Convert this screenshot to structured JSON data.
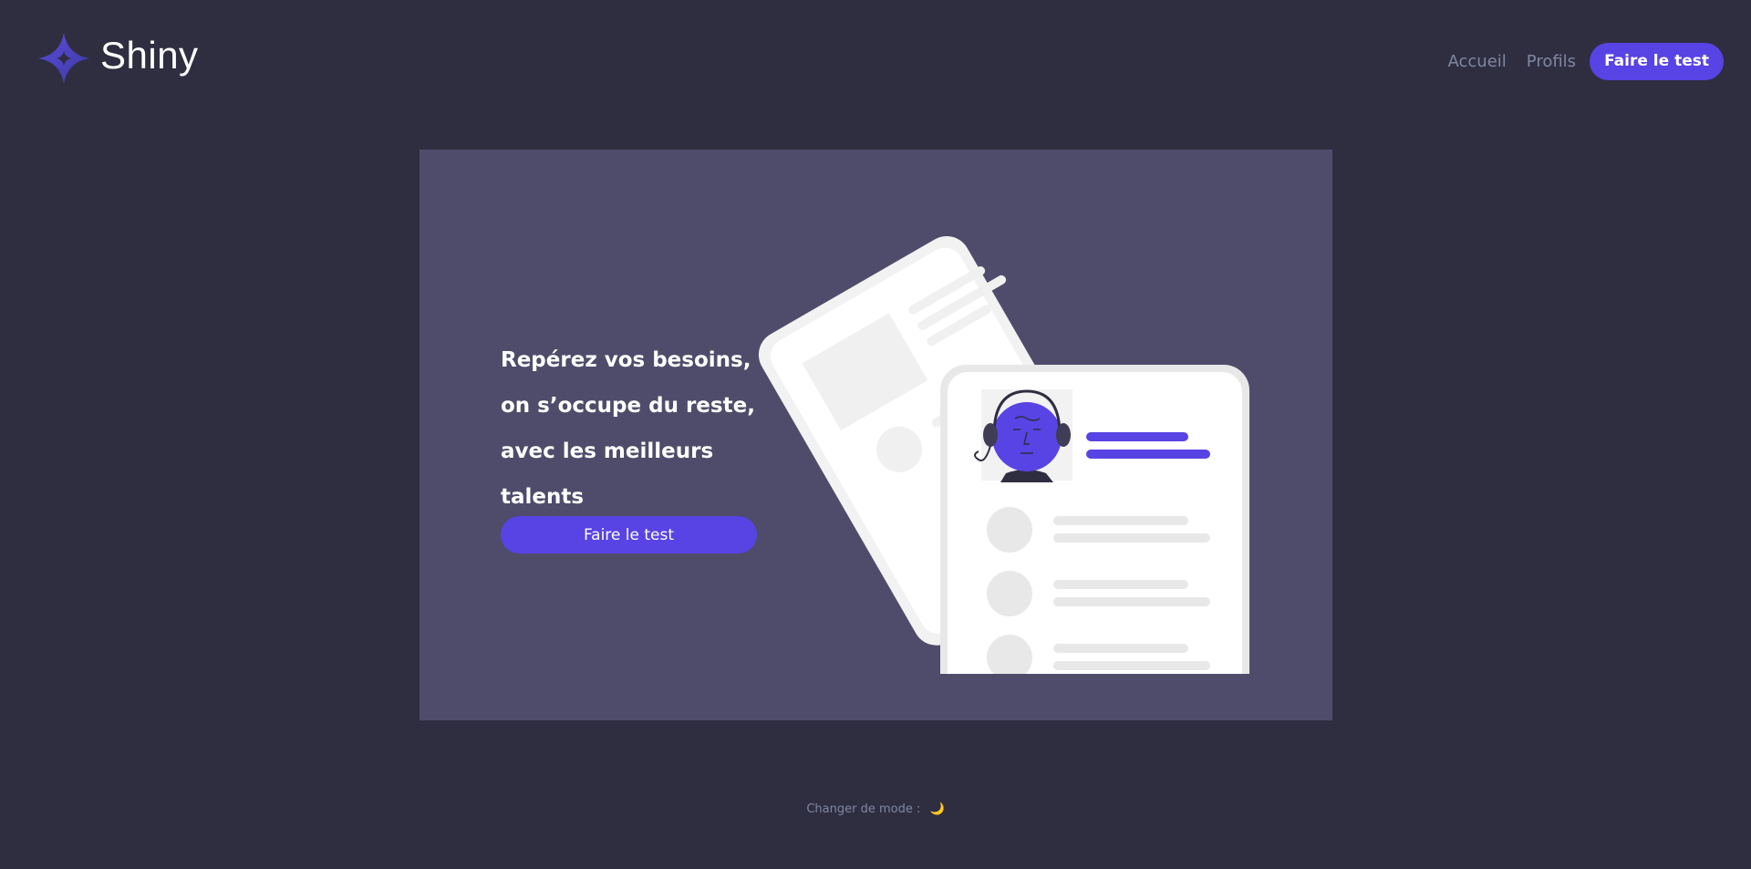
{
  "app": {
    "brand": "Shiny",
    "logo_icon": "four-point-star-icon"
  },
  "nav": {
    "home_label": "Accueil",
    "profiles_label": "Profils",
    "test_label": "Faire le test"
  },
  "hero": {
    "title": "Repérez vos besoins, on s’occupe du reste, avec les meilleurs talents",
    "cta_label": "Faire le test",
    "illustration": "profile-cards-illustration"
  },
  "footer": {
    "mode_label": "Changer de mode :",
    "mode_icon": "🌙"
  },
  "colors": {
    "background": "#2f2e41",
    "hero_background": "#4f4c6b",
    "accent": "#5843e4",
    "nav_text": "#8186a0",
    "text": "#ffffff"
  }
}
